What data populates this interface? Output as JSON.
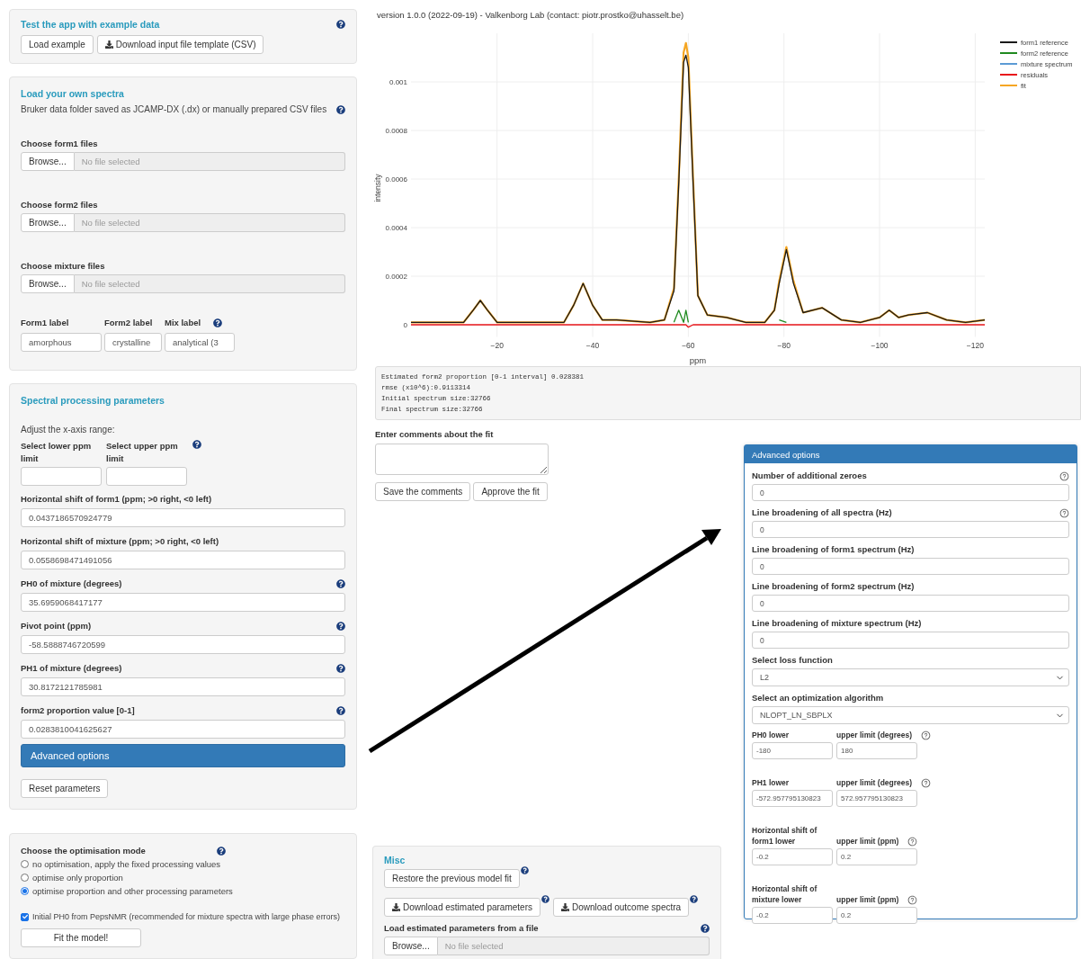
{
  "header": {
    "version": "version 1.0.0 (2022-09-19) - Valkenborg Lab (contact: piotr.prostko@uhasselt.be)"
  },
  "example_panel": {
    "title": "Test the app with example data",
    "help": true,
    "buttons": [
      {
        "label": "Load example",
        "kind": "plain"
      },
      {
        "label": "Download input file template (CSV)",
        "kind": "download"
      }
    ]
  },
  "spectra_panel": {
    "title": "Load your own spectra",
    "description": "Bruker data folder saved as JCAMP-DX (.dx) or manually prepared CSV files",
    "help": true,
    "file_inputs": [
      {
        "label": "Choose form1 files",
        "button": "Browse...",
        "placeholder": "No file selected"
      },
      {
        "label": "Choose form2 files",
        "button": "Browse...",
        "placeholder": "No file selected"
      },
      {
        "label": "Choose mixture files",
        "button": "Browse...",
        "placeholder": "No file selected"
      }
    ],
    "label_fields": [
      {
        "label": "Form1 label",
        "value": "amorphous",
        "help": false
      },
      {
        "label": "Form2 label",
        "value": "crystalline",
        "help": false
      },
      {
        "label": "Mix label",
        "value": "analytical (3",
        "help": true
      }
    ]
  },
  "processing_panel": {
    "title": "Spectral processing parameters",
    "range_label": "Adjust the x-axis range:",
    "range_fields": [
      {
        "label": "Select lower ppm limit",
        "help": false
      },
      {
        "label": "Select upper ppm limit",
        "help": true
      }
    ],
    "fields": [
      {
        "label": "Horizontal shift of form1 (ppm; >0 right, <0 left)",
        "value": "0.0437186570924779",
        "help": false
      },
      {
        "label": "Horizontal shift of mixture (ppm; >0 right, <0 left)",
        "value": "0.0558698471491056",
        "help": false
      },
      {
        "label": "PH0 of mixture (degrees)",
        "value": "35.6959068417177",
        "help": true
      },
      {
        "label": "Pivot point (ppm)",
        "value": "-58.5888746720599",
        "help": true
      },
      {
        "label": "PH1 of mixture (degrees)",
        "value": "30.8172121785981",
        "help": true
      },
      {
        "label": "form2 proportion value [0-1]",
        "value": "0.0283810041625627",
        "help": true
      }
    ],
    "advanced_button": "Advanced options",
    "reset_button": "Reset parameters"
  },
  "optimisation_panel": {
    "title": "Choose the optimisation mode",
    "help": true,
    "options": [
      {
        "label": "no optimisation, apply the fixed processing values",
        "selected": false
      },
      {
        "label": "optimise only proportion",
        "selected": false
      },
      {
        "label": "optimise proportion and other processing parameters",
        "selected": true
      }
    ],
    "checkbox": {
      "label": "Initial PH0 from PepsNMR (recommended for mixture spectra with large phase errors)",
      "checked": true
    },
    "fit_button": "Fit the model!"
  },
  "spectrum_plot": {
    "chart_data": {
      "type": "line",
      "xlabel": "ppm",
      "ylabel": "intensity",
      "grid": true,
      "legend": true,
      "x": [
        -2,
        -10,
        -13,
        -15,
        -16.5,
        -18,
        -20,
        -23,
        -30,
        -34,
        -36,
        -38,
        -40,
        -42,
        -45,
        -52,
        -55,
        -57,
        -58,
        -59,
        -59.5,
        -60,
        -61,
        -62,
        -64,
        -68,
        -72,
        -76,
        -78,
        -79,
        -80.5,
        -82,
        -84,
        -88,
        -92,
        -96,
        -100,
        -102,
        -104,
        -106,
        -110,
        -114,
        -118,
        -122
      ],
      "series": [
        {
          "name": "form1 reference",
          "color": "#1a1a1a",
          "values": [
            1e-05,
            1e-05,
            1e-05,
            6e-05,
            0.0001,
            6e-05,
            1e-05,
            1e-05,
            1e-05,
            1e-05,
            8e-05,
            0.00017,
            8e-05,
            2e-05,
            2e-05,
            1e-05,
            2e-05,
            0.00014,
            0.00058,
            0.00108,
            0.00111,
            0.00106,
            0.00058,
            0.00012,
            4e-05,
            3e-05,
            1e-05,
            1e-05,
            6e-05,
            0.00017,
            0.00031,
            0.00017,
            5e-05,
            7e-05,
            2e-05,
            1e-05,
            3e-05,
            6e-05,
            3e-05,
            4e-05,
            5e-05,
            2e-05,
            1e-05,
            2e-05
          ]
        },
        {
          "name": "form2 reference",
          "color": "#1f8a1f",
          "values": [
            null,
            null,
            null,
            null,
            null,
            null,
            null,
            null,
            null,
            null,
            null,
            null,
            null,
            null,
            null,
            null,
            null,
            1e-05,
            6e-05,
            1e-05,
            6e-05,
            1e-05,
            null,
            null,
            null,
            null,
            null,
            null,
            null,
            2e-05,
            1e-05,
            null,
            null,
            null,
            null,
            null,
            null,
            null,
            null,
            null,
            null,
            null,
            null,
            null
          ]
        },
        {
          "name": "mixture spectrum",
          "color": "#5b9bd5",
          "values": [
            null,
            null,
            null,
            null,
            null,
            null,
            null,
            null,
            null,
            null,
            null,
            null,
            null,
            null,
            null,
            null,
            null,
            null,
            null,
            null,
            null,
            null,
            null,
            null,
            null,
            null,
            null,
            null,
            null,
            null,
            null,
            null,
            null,
            null,
            null,
            null,
            null,
            null,
            null,
            null,
            null,
            null,
            null,
            null
          ]
        },
        {
          "name": "residuals",
          "color": "#e8161b",
          "values": [
            0,
            0,
            0,
            0,
            0,
            0,
            0,
            0,
            0,
            0,
            0,
            0,
            0,
            0,
            0,
            0,
            0,
            0,
            0,
            0,
            0,
            -1e-05,
            0,
            0,
            0,
            0,
            0,
            0,
            0,
            0,
            0,
            0,
            0,
            0,
            0,
            0,
            0,
            0,
            0,
            0,
            0,
            0,
            0,
            0
          ]
        },
        {
          "name": "fit",
          "color": "#f5a623",
          "values": [
            1e-05,
            1e-05,
            1e-05,
            6e-05,
            0.0001,
            6e-05,
            1e-05,
            1e-05,
            1e-05,
            1e-05,
            8e-05,
            0.00017,
            8e-05,
            2e-05,
            2e-05,
            1e-05,
            2e-05,
            0.00015,
            0.0006,
            0.00112,
            0.00116,
            0.0011,
            0.0006,
            0.00012,
            4e-05,
            3e-05,
            1e-05,
            1e-05,
            6e-05,
            0.00018,
            0.00032,
            0.00018,
            5e-05,
            7e-05,
            2e-05,
            1e-05,
            3e-05,
            6e-05,
            3e-05,
            4e-05,
            5e-05,
            2e-05,
            1e-05,
            2e-05
          ]
        }
      ],
      "xlim": [
        -2,
        -122
      ],
      "ylim": [
        -5e-05,
        0.0012
      ],
      "xticks": [
        {
          "value": -20,
          "label": "−20"
        },
        {
          "value": -40,
          "label": "−40"
        },
        {
          "value": -60,
          "label": "−60"
        },
        {
          "value": -80,
          "label": "−80"
        },
        {
          "value": -100,
          "label": "−100"
        },
        {
          "value": -120,
          "label": "−120"
        }
      ],
      "yticks": [
        0,
        0.0002,
        0.0004,
        0.0006,
        0.0008,
        0.001
      ]
    }
  },
  "output": [
    "Estimated form2 proportion [0-1 interval] 0.028381",
    "rmse (x10^6):0.9113314",
    "Initial spectrum size:32766",
    "Final spectrum size:32766"
  ],
  "comments": {
    "label": "Enter comments about the fit",
    "buttons": [
      "Save the comments",
      "Approve the fit"
    ]
  },
  "misc_panel": {
    "title": "Misc",
    "restore_button": {
      "label": "Restore the previous model fit",
      "help": true
    },
    "download_buttons": [
      {
        "label": "Download estimated parameters",
        "help": true
      },
      {
        "label": "Download outcome spectra",
        "help": true
      }
    ],
    "load_input": {
      "label": "Load estimated parameters from a file",
      "help": true,
      "button": "Browse...",
      "placeholder": "No file selected"
    }
  },
  "advanced_panel": {
    "title": "Advanced options",
    "items": [
      {
        "kind": "input",
        "label": "Number of additional zeroes",
        "value": "0",
        "help": true
      },
      {
        "kind": "input",
        "label": "Line broadening of all spectra (Hz)",
        "value": "0",
        "help": true
      },
      {
        "kind": "input",
        "label": "Line broadening of form1 spectrum (Hz)",
        "value": "0",
        "help": false
      },
      {
        "kind": "input",
        "label": "Line broadening of form2 spectrum (Hz)",
        "value": "0",
        "help": false
      },
      {
        "kind": "input",
        "label": "Line broadening of mixture spectrum (Hz)",
        "value": "0",
        "help": false
      },
      {
        "kind": "select",
        "label": "Select loss function",
        "value": "L2",
        "help": false
      },
      {
        "kind": "select",
        "label": "Select an optimization algorithm",
        "value": "NLOPT_LN_SBPLX",
        "help": false
      },
      {
        "kind": "range",
        "lower_label": "PH0 lower",
        "upper_label": "upper limit (degrees)",
        "lower": "-180",
        "upper": "180",
        "help": true
      },
      {
        "kind": "range",
        "lower_label": "PH1 lower",
        "upper_label": "upper limit (degrees)",
        "lower": "-572.957795130823",
        "upper": "572.957795130823",
        "help": true
      },
      {
        "kind": "range",
        "lower_label": "Horizontal shift of form1 lower",
        "upper_label": "upper limit (ppm)",
        "lower": "-0.2",
        "upper": "0.2",
        "help": true
      },
      {
        "kind": "range",
        "lower_label": "Horizontal shift of mixture lower",
        "upper_label": "upper limit (ppm)",
        "lower": "-0.2",
        "upper": "0.2",
        "help": true
      }
    ]
  }
}
